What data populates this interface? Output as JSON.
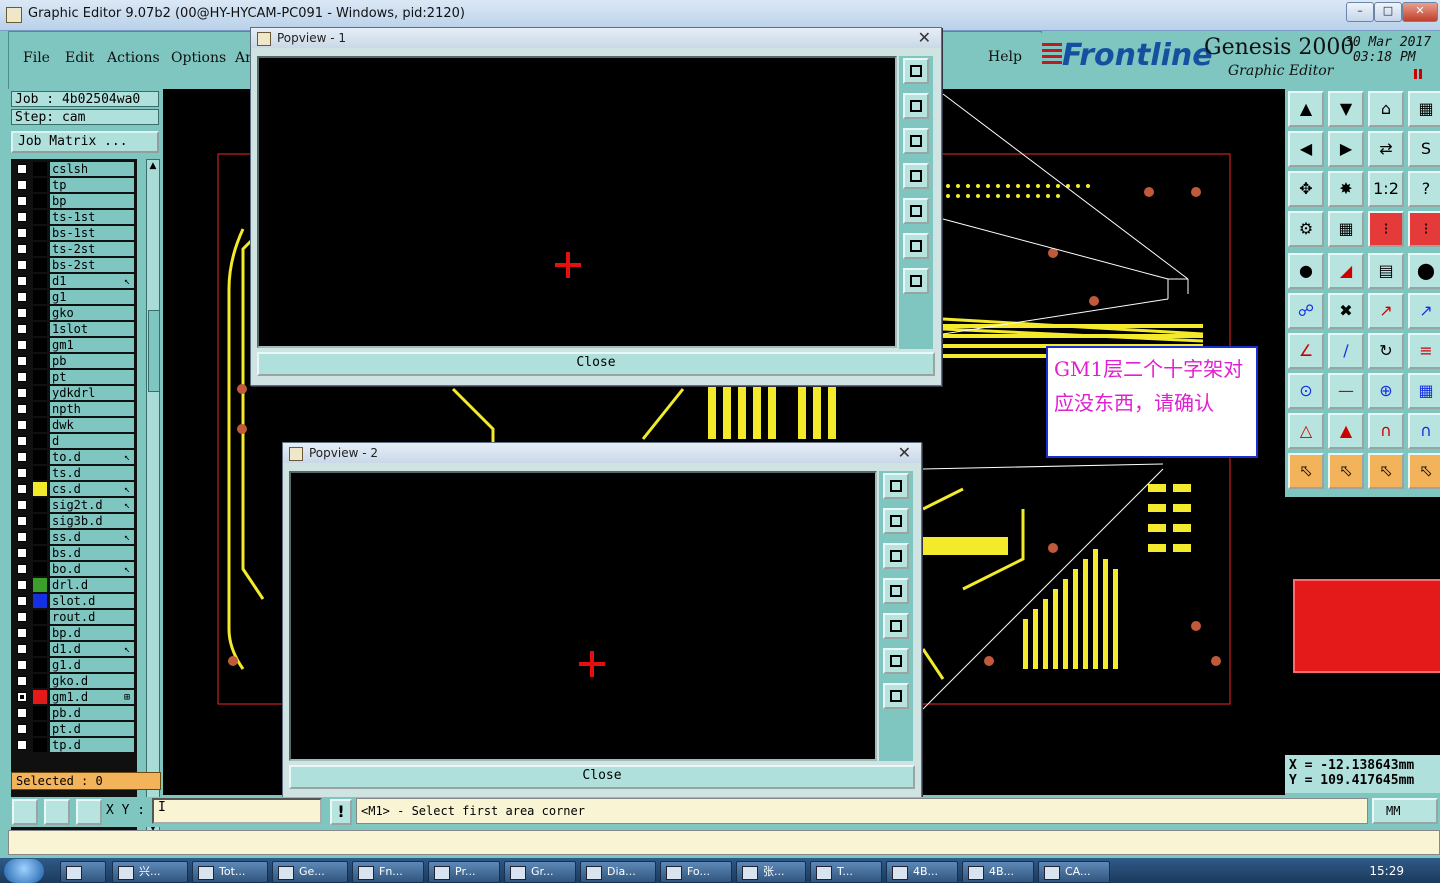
{
  "window": {
    "title": "Graphic Editor 9.07b2 (00@HY-HYCAM-PC091 - Windows, pid:2120)"
  },
  "menu": {
    "items": [
      "File",
      "Edit",
      "Actions",
      "Options",
      "Ar"
    ],
    "help": "Help"
  },
  "brand": {
    "name": "Frontline",
    "product": "Genesis 2000",
    "subtitle": "Graphic Editor",
    "date_line1": "30 Mar 2017",
    "date_line2": "03:18 PM"
  },
  "job": {
    "job_label": "Job : 4b02504wa0",
    "step_label": "Step: cam",
    "matrix_button": "Job Matrix ..."
  },
  "layers": [
    {
      "name": "cslsh",
      "color": "#000000",
      "mark": ""
    },
    {
      "name": "tp",
      "color": "#000000",
      "mark": ""
    },
    {
      "name": "bp",
      "color": "#000000",
      "mark": ""
    },
    {
      "name": "ts-1st",
      "color": "#000000",
      "mark": ""
    },
    {
      "name": "bs-1st",
      "color": "#000000",
      "mark": ""
    },
    {
      "name": "ts-2st",
      "color": "#000000",
      "mark": ""
    },
    {
      "name": "bs-2st",
      "color": "#000000",
      "mark": ""
    },
    {
      "name": "d1",
      "color": "#000000",
      "mark": "↖"
    },
    {
      "name": "g1",
      "color": "#000000",
      "mark": ""
    },
    {
      "name": "gko",
      "color": "#000000",
      "mark": ""
    },
    {
      "name": "1slot",
      "color": "#000000",
      "mark": ""
    },
    {
      "name": "gm1",
      "color": "#000000",
      "mark": ""
    },
    {
      "name": "pb",
      "color": "#000000",
      "mark": ""
    },
    {
      "name": "pt",
      "color": "#000000",
      "mark": ""
    },
    {
      "name": "ydkdrl",
      "color": "#000000",
      "mark": ""
    },
    {
      "name": "npth",
      "color": "#000000",
      "mark": ""
    },
    {
      "name": "dwk",
      "color": "#000000",
      "mark": ""
    },
    {
      "name": "d",
      "color": "#000000",
      "mark": ""
    },
    {
      "name": "to.d",
      "color": "#000000",
      "mark": "↖"
    },
    {
      "name": "ts.d",
      "color": "#000000",
      "mark": ""
    },
    {
      "name": "cs.d",
      "color": "#f2ea2a",
      "mark": "↖"
    },
    {
      "name": "sig2t.d",
      "color": "#000000",
      "mark": "↖"
    },
    {
      "name": "sig3b.d",
      "color": "#000000",
      "mark": ""
    },
    {
      "name": "ss.d",
      "color": "#000000",
      "mark": "↖"
    },
    {
      "name": "bs.d",
      "color": "#000000",
      "mark": ""
    },
    {
      "name": "bo.d",
      "color": "#000000",
      "mark": "↖"
    },
    {
      "name": "drl.d",
      "color": "#3aa02a",
      "mark": ""
    },
    {
      "name": "slot.d",
      "color": "#1430e0",
      "mark": ""
    },
    {
      "name": "rout.d",
      "color": "#000000",
      "mark": ""
    },
    {
      "name": "bp.d",
      "color": "#000000",
      "mark": ""
    },
    {
      "name": "d1.d",
      "color": "#000000",
      "mark": "↖"
    },
    {
      "name": "g1.d",
      "color": "#000000",
      "mark": ""
    },
    {
      "name": "gko.d",
      "color": "#000000",
      "mark": ""
    },
    {
      "name": "gm1.d",
      "color": "#e41a1a",
      "mark": "⊞"
    },
    {
      "name": "pb.d",
      "color": "#000000",
      "mark": ""
    },
    {
      "name": "pt.d",
      "color": "#000000",
      "mark": ""
    },
    {
      "name": "tp.d",
      "color": "#000000",
      "mark": ""
    }
  ],
  "selected": {
    "label": "Selected : 0"
  },
  "popup1": {
    "title": "Popview - 1",
    "close": "Close"
  },
  "popup2": {
    "title": "Popview - 2",
    "close": "Close"
  },
  "note": {
    "text": "GM1层二个十字架对应没东西，请确认"
  },
  "toolbar_glyphs": {
    "ratio": "1:2",
    "question": "?"
  },
  "coords": {
    "x": "X = -12.138643mm",
    "y": "Y = 109.417645mm"
  },
  "status": {
    "xy_label": "X Y :",
    "xy_value": "I",
    "bang": "!",
    "message": "<M1> - Select first area corner",
    "unit": "MM"
  },
  "taskbar": {
    "tasks": [
      "兴...",
      "Tot...",
      "Ge...",
      "Fn...",
      "Pr...",
      "Gr...",
      "Dia...",
      "Fo...",
      "张...",
      "T...",
      "4B...",
      "4B...",
      "CA..."
    ],
    "clock": "15:29"
  },
  "colors": {
    "accent": "#7fc5c0",
    "copper": "#f2ea2a",
    "selection": "#e41a1a",
    "note_text": "#e020d0"
  }
}
